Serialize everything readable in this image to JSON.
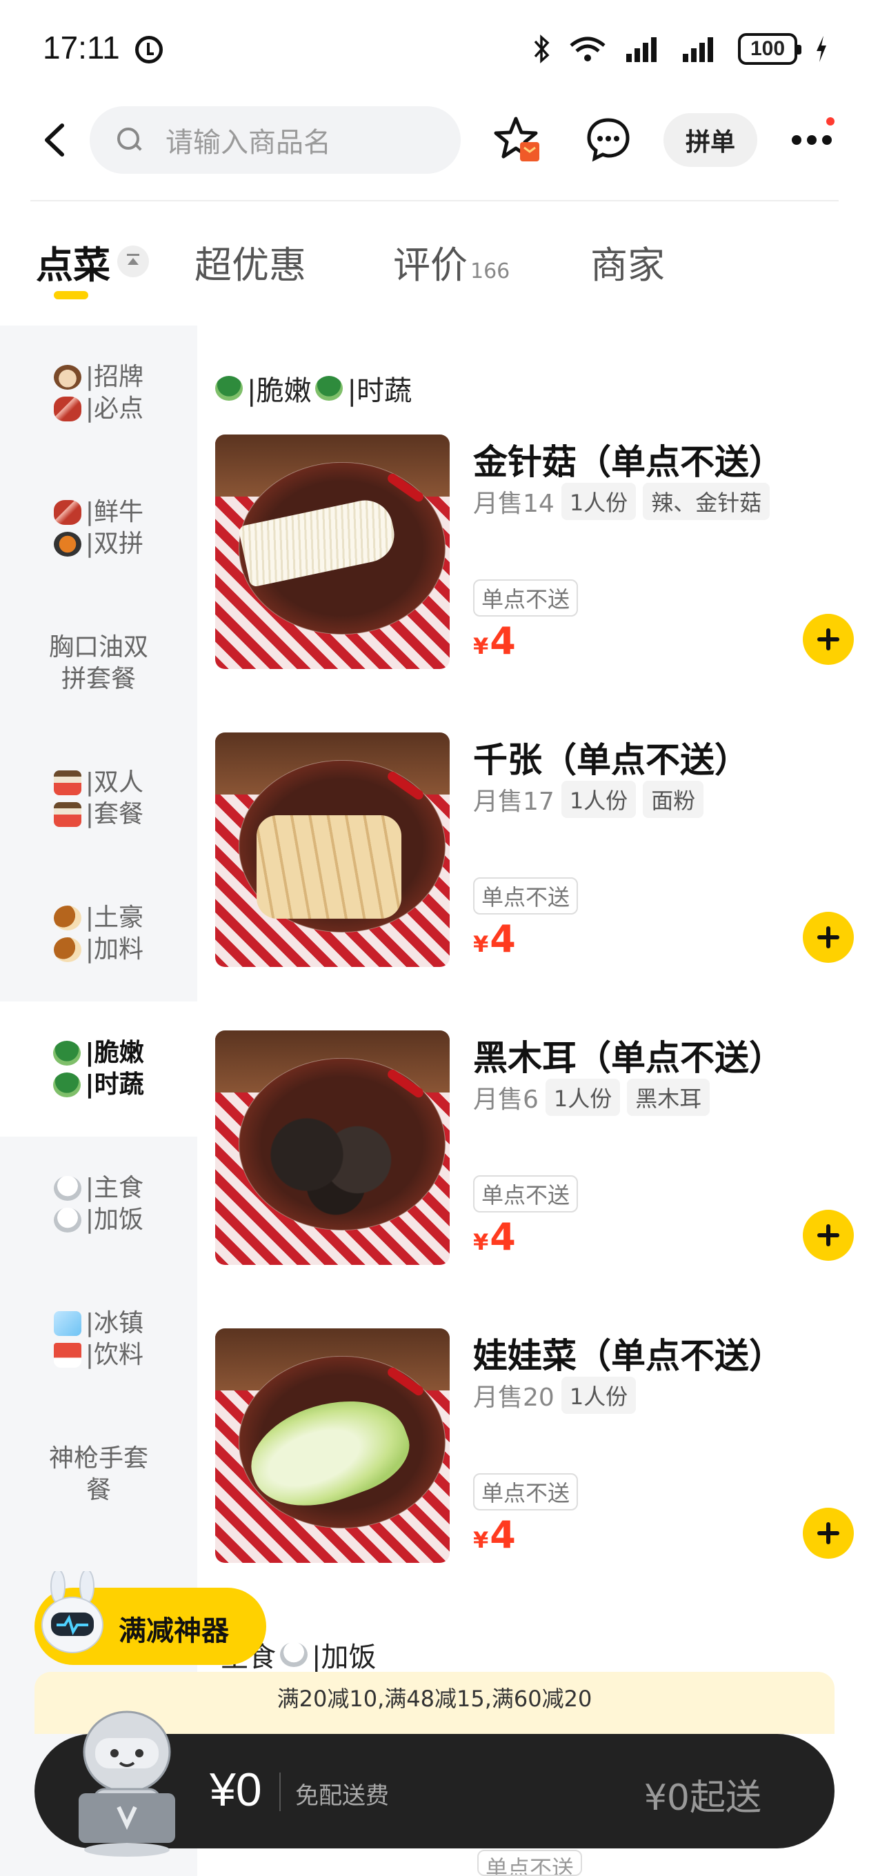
{
  "status_bar": {
    "time": "17:11",
    "battery": "100"
  },
  "header": {
    "search_placeholder": "请输入商品名",
    "group_order_label": "拼单"
  },
  "tabs": [
    {
      "label": "点菜",
      "active": true
    },
    {
      "label": "超优惠"
    },
    {
      "label": "评价",
      "count": "166"
    },
    {
      "label": "商家"
    }
  ],
  "sidebar": {
    "categories": [
      {
        "line1": "|招牌",
        "line2": "|必点",
        "icon1": "cow-face-icon",
        "icon2": "meat-icon"
      },
      {
        "line1": "|鲜牛",
        "line2": "|双拼",
        "icon1": "meat-icon",
        "icon2": "hotpot-icon"
      },
      {
        "line1": "胸口油双",
        "line2": "拼套餐"
      },
      {
        "line1": "|双人",
        "line2": "|套餐",
        "icon1": "bento-box-icon",
        "icon2": "bento-box-icon"
      },
      {
        "line1": "|土豪",
        "line2": "|加料",
        "icon1": "drumstick-icon",
        "icon2": "drumstick-icon"
      },
      {
        "line1": "|脆嫩",
        "line2": "|时蔬",
        "icon1": "broccoli-icon",
        "icon2": "broccoli-icon",
        "active": true
      },
      {
        "line1": "|主食",
        "line2": "|加饭",
        "icon1": "rice-bowl-icon",
        "icon2": "rice-bowl-icon"
      },
      {
        "line1": "|冰镇",
        "line2": "|饮料",
        "icon1": "ice-cube-icon",
        "icon2": "drink-cup-icon"
      },
      {
        "line1": "神枪手套",
        "line2": "餐"
      }
    ]
  },
  "section": {
    "title_a": "|脆嫩",
    "title_b": "|时蔬",
    "icon": "broccoli-icon"
  },
  "items": [
    {
      "name": "金针菇（单点不送）",
      "sold": "月售14",
      "tags": [
        "1人份",
        "辣、金针菇"
      ],
      "badge": "单点不送",
      "currency": "¥",
      "price": "4"
    },
    {
      "name": "千张（单点不送）",
      "sold": "月售17",
      "tags": [
        "1人份",
        "面粉"
      ],
      "badge": "单点不送",
      "currency": "¥",
      "price": "4"
    },
    {
      "name": "黑木耳（单点不送）",
      "sold": "月售6",
      "tags": [
        "1人份",
        "黑木耳"
      ],
      "badge": "单点不送",
      "currency": "¥",
      "price": "4"
    },
    {
      "name": "娃娃菜（单点不送）",
      "sold": "月售20",
      "tags": [
        "1人份"
      ],
      "badge": "单点不送",
      "currency": "¥",
      "price": "4"
    }
  ],
  "next_section": {
    "title_a": "主食",
    "title_b": "|加饭"
  },
  "promo": {
    "chip_label": "满减神器",
    "discount_text": "满20减10,满48减15,满60减20"
  },
  "cart": {
    "total": "¥0",
    "delivery_fee": "免配送费",
    "min_order": "¥0起送"
  },
  "bottom_badge": "单点不送",
  "colors": {
    "accent": "#ffd100",
    "price": "#ff3b1f",
    "cart_bg": "#222222"
  }
}
